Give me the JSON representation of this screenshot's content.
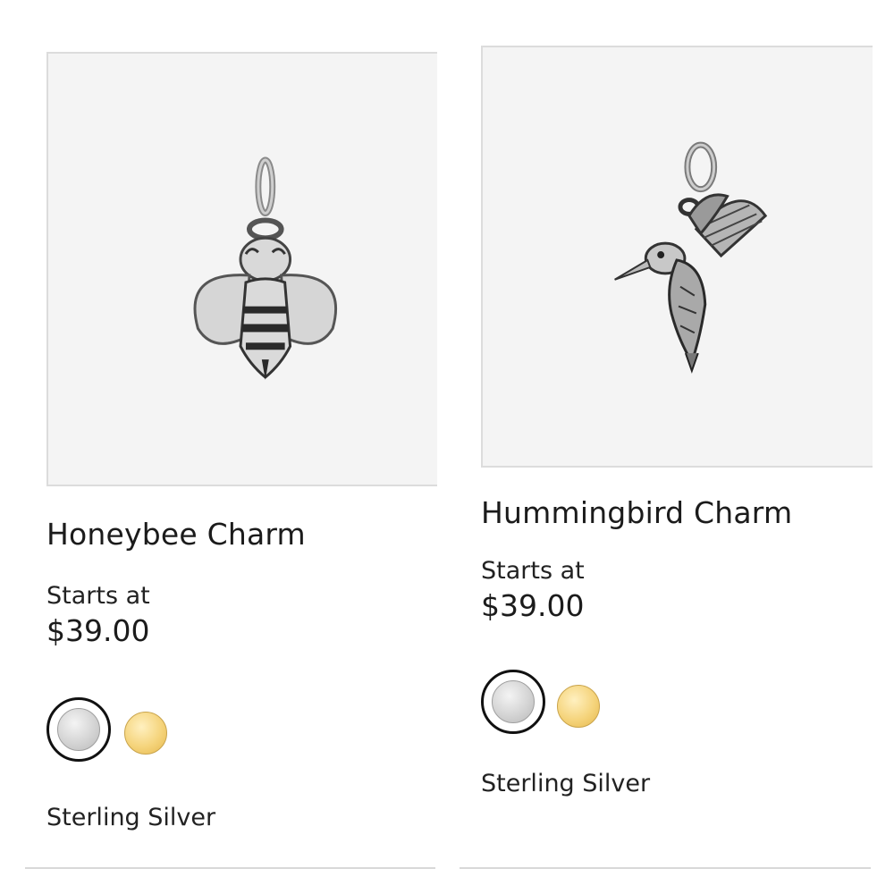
{
  "products": [
    {
      "image_icon": "honeybee-charm-image",
      "title": "Honeybee Charm",
      "starts_label": "Starts at",
      "price": "$39.00",
      "swatches": [
        "sterling-silver",
        "gold"
      ],
      "selected_metal": "Sterling Silver"
    },
    {
      "image_icon": "hummingbird-charm-image",
      "title": "Hummingbird Charm",
      "starts_label": "Starts at",
      "price": "$39.00",
      "swatches": [
        "sterling-silver",
        "gold"
      ],
      "selected_metal": "Sterling Silver"
    }
  ],
  "colors": {
    "image_background": "#f4f4f4",
    "silver_swatch": "#d4d4d4",
    "gold_swatch": "#f5d47c",
    "selected_ring": "#111111"
  }
}
